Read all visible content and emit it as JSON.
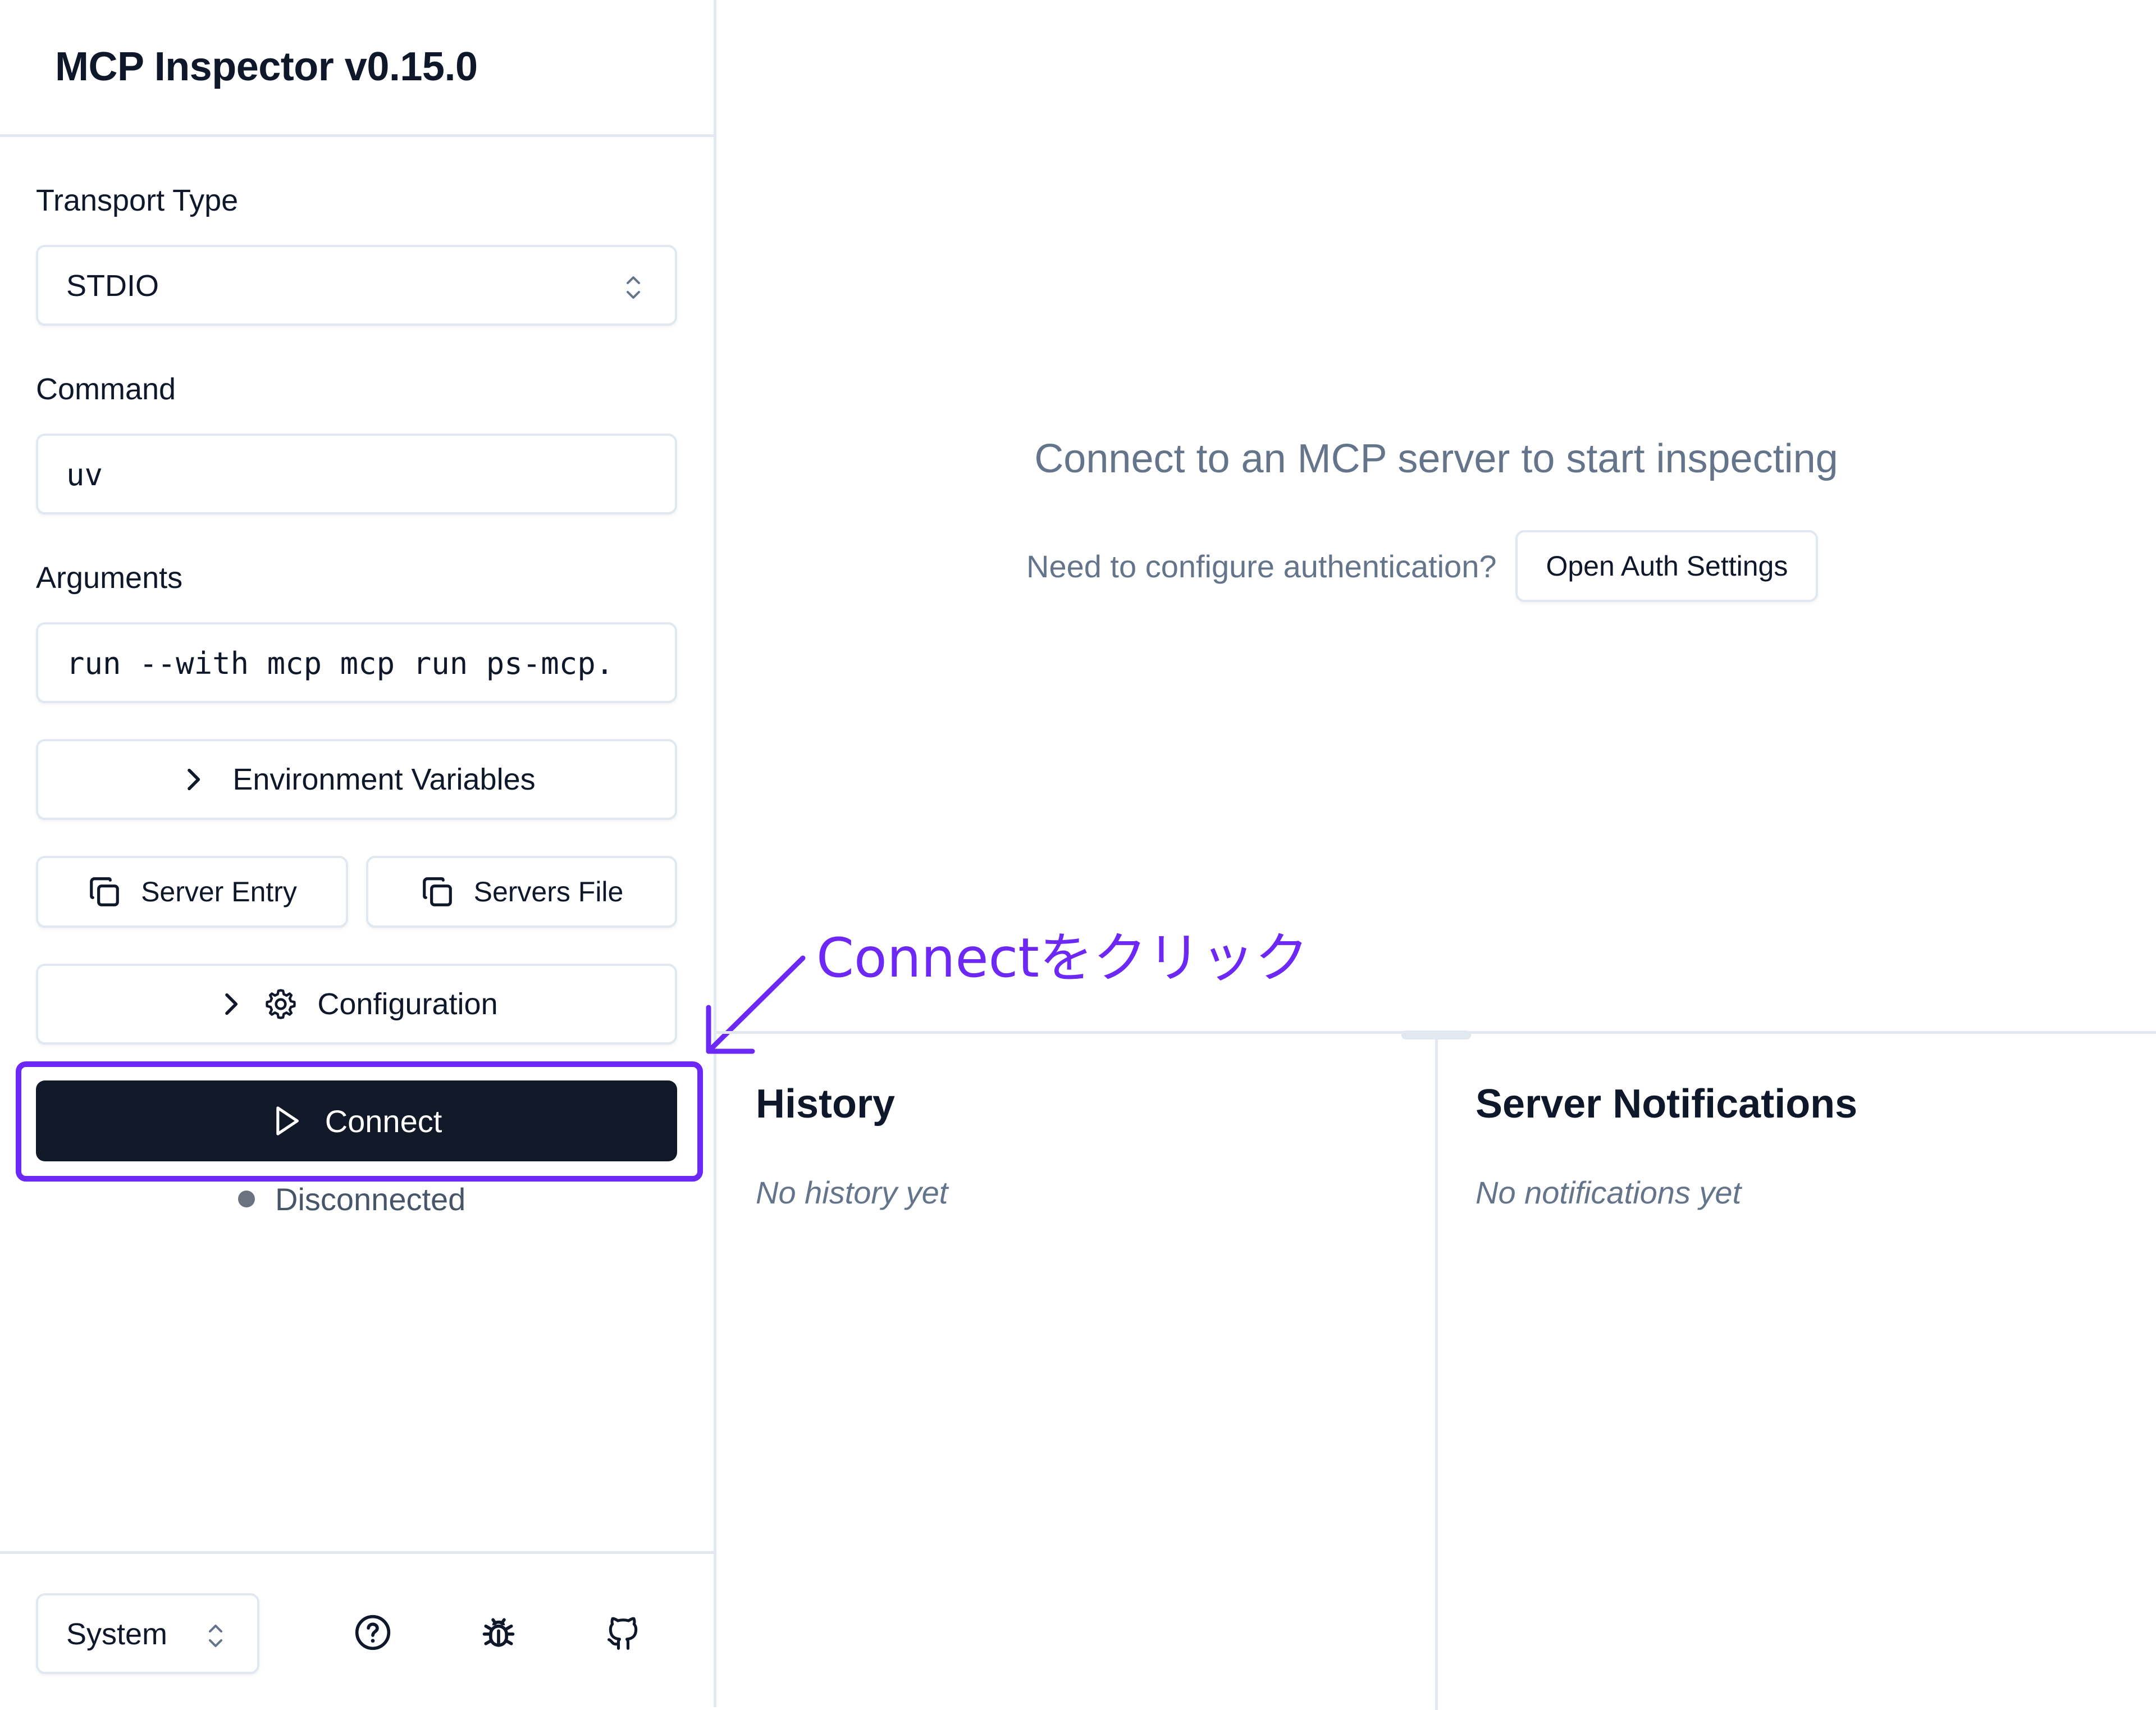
{
  "app": {
    "title": "MCP Inspector v0.15.0"
  },
  "sidebar": {
    "transport_label": "Transport Type",
    "transport_value": "STDIO",
    "command_label": "Command",
    "command_value": "uv",
    "arguments_label": "Arguments",
    "arguments_value": "run --with mcp mcp run ps-mcp.",
    "env_button": "Environment Variables",
    "server_entry_button": "Server Entry",
    "servers_file_button": "Servers File",
    "config_button": "Configuration",
    "connect_button": "Connect",
    "status_text": "Disconnected",
    "theme_value": "System"
  },
  "main": {
    "empty_title": "Connect to an MCP server to start inspecting",
    "auth_prompt": "Need to configure authentication?",
    "auth_button": "Open Auth Settings",
    "history_title": "History",
    "history_empty": "No history yet",
    "notifications_title": "Server Notifications",
    "notifications_empty": "No notifications yet"
  },
  "annotation": {
    "text": "Connectをクリック"
  },
  "colors": {
    "annotation": "#6d28f5",
    "connect_bg": "#111827",
    "border": "#e2e8f0",
    "muted_text": "#64748b",
    "status_dot": "#6b7280"
  },
  "icons": {
    "transport_select": "chevron-up-down-icon",
    "env": "chevron-right-icon",
    "copy": "copy-icon",
    "config": "gear-icon",
    "connect": "play-icon",
    "help": "help-circle-icon",
    "bug": "bug-icon",
    "github": "github-icon"
  }
}
